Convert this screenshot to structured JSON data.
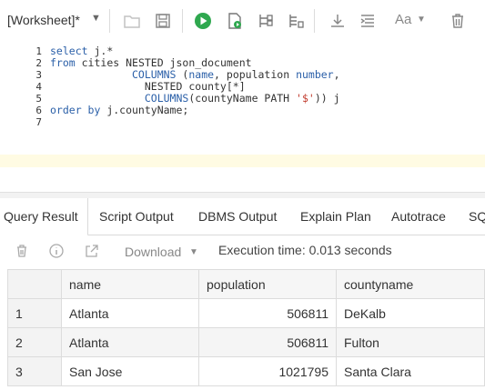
{
  "toolbar": {
    "worksheet_label": "[Worksheet]*",
    "font_label": "Aa",
    "icons": [
      "folder-open-icon",
      "save-icon",
      "run-icon",
      "run-script-icon",
      "explain-plan-icon",
      "autotrace-icon",
      "download-icon",
      "format-icon",
      "font-icon",
      "trash-icon"
    ],
    "run_color": "#2fa84f"
  },
  "editor": {
    "line_numbers": [
      "1",
      "2",
      "3",
      "4",
      "5",
      "6",
      "7"
    ],
    "lines": [
      [
        {
          "t": "select",
          "k": "kw"
        },
        {
          "t": " j.*",
          "k": ""
        }
      ],
      [
        {
          "t": "from",
          "k": "kw"
        },
        {
          "t": " cities NESTED json_document",
          "k": ""
        }
      ],
      [
        {
          "t": "             COLUMNS",
          "k": "kw"
        },
        {
          "t": " (",
          "k": ""
        },
        {
          "t": "name",
          "k": "kw"
        },
        {
          "t": ", population ",
          "k": ""
        },
        {
          "t": "number",
          "k": "kw"
        },
        {
          "t": ",",
          "k": ""
        }
      ],
      [
        {
          "t": "               NESTED county[*]",
          "k": ""
        }
      ],
      [
        {
          "t": "               COLUMNS",
          "k": "kw"
        },
        {
          "t": "(countyName PATH ",
          "k": ""
        },
        {
          "t": "'$'",
          "k": "str"
        },
        {
          "t": ")) j",
          "k": ""
        }
      ],
      [
        {
          "t": "order by",
          "k": "kw"
        },
        {
          "t": " j.countyName;",
          "k": ""
        }
      ],
      []
    ]
  },
  "tabs": [
    "Query Result",
    "Script Output",
    "DBMS Output",
    "Explain Plan",
    "Autotrace",
    "SQ"
  ],
  "results_toolbar": {
    "download_label": "Download",
    "execution_text": "Execution time: 0.013 seconds"
  },
  "grid": {
    "columns": [
      "name",
      "population",
      "countyname"
    ],
    "rows": [
      {
        "num": "1",
        "name": "Atlanta",
        "population": "506811",
        "countyname": "DeKalb"
      },
      {
        "num": "2",
        "name": "Atlanta",
        "population": "506811",
        "countyname": "Fulton"
      },
      {
        "num": "3",
        "name": "San Jose",
        "population": "1021795",
        "countyname": "Santa Clara"
      }
    ]
  }
}
